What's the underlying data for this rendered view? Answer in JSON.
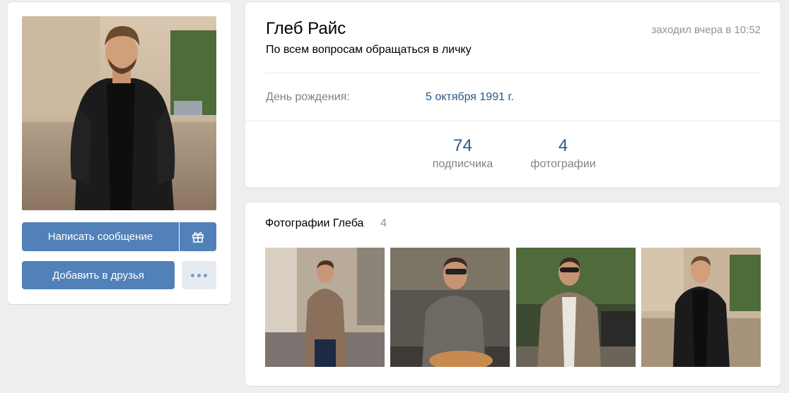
{
  "profile": {
    "name": "Глеб Райс",
    "status": "По всем вопросам обращаться в личку",
    "last_seen": "заходил вчера в 10:52",
    "birthday_label": "День рождения:",
    "birthday_value": "5 октября 1991 г."
  },
  "counters": [
    {
      "number": "74",
      "label": "подписчика"
    },
    {
      "number": "4",
      "label": "фотографии"
    }
  ],
  "actions": {
    "message_label": "Написать сообщение",
    "gift_icon": "gift-icon",
    "add_friend_label": "Добавить в друзья",
    "more_icon": "more-dots-icon"
  },
  "photos": {
    "title": "Фотографии Глеба",
    "count": "4"
  },
  "colors": {
    "accent": "#5181b8",
    "link": "#2a5885",
    "background": "#edeef0"
  }
}
